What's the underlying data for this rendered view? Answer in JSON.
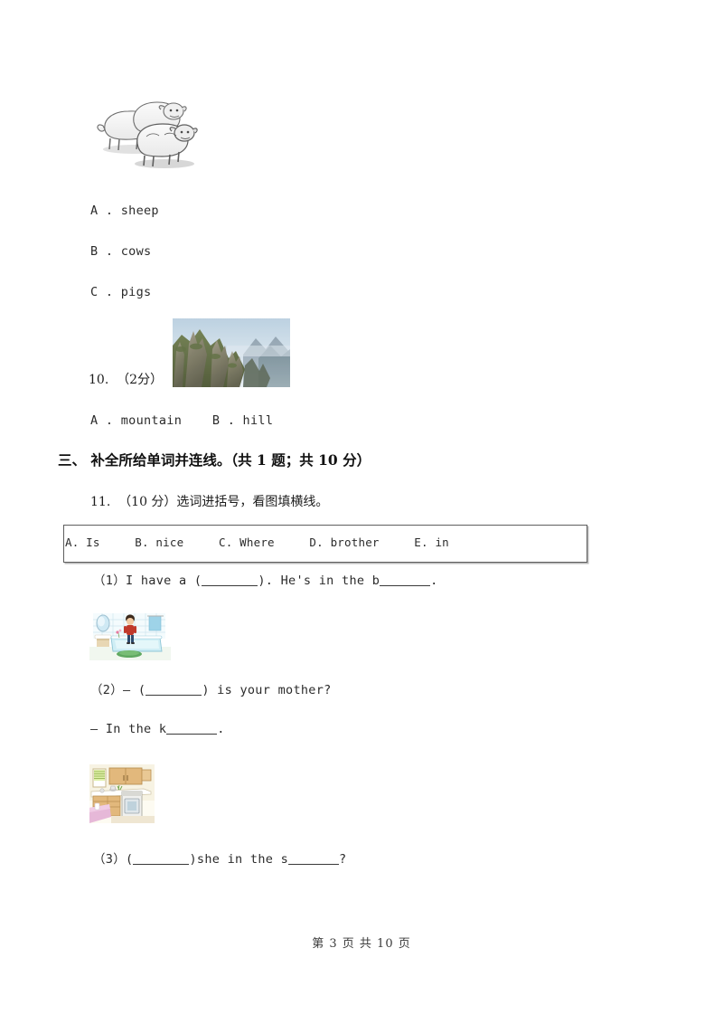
{
  "document": {
    "type": "exam-paper",
    "language": "zh-CN + en"
  },
  "question_9": {
    "image_alt": "three-sheep-line-drawing",
    "options": [
      {
        "key": "A",
        "text": "A . sheep"
      },
      {
        "key": "B",
        "text": "B . cows"
      },
      {
        "key": "C",
        "text": "C . pigs"
      }
    ]
  },
  "question_10": {
    "number_and_points": "10.  （2分）",
    "image_alt": "mountain-peaks-photo",
    "options_line": "A . mountain    B . hill"
  },
  "section_3": {
    "heading": "三、 补全所给单词并连线。（共 1 题；共 10 分）"
  },
  "question_11": {
    "stem": "11.  （10 分）选词进括号，看图填横线。",
    "word_bank": "A. Is     B. nice     C. Where     D. brother     E. in",
    "sub_questions": {
      "one": {
        "prefix": "（1）I have a (",
        "middle": "). He's in the b",
        "suffix": "."
      },
      "two": {
        "image_alt": "bathroom-with-boy-illustration",
        "prefix": "（2）— (",
        "middle": ") is your mother?",
        "answer_prefix": "— In the k",
        "answer_suffix": "."
      },
      "three": {
        "image_alt": "kitchen-illustration",
        "prefix": "（3）(",
        "middle": ")she in the s",
        "suffix": "?"
      }
    }
  },
  "footer": {
    "page_text": "第 3 页 共 10 页"
  },
  "colors": {
    "text": "#231f20",
    "border": "#5e5e5e",
    "shadow": "#b8b8b8"
  }
}
